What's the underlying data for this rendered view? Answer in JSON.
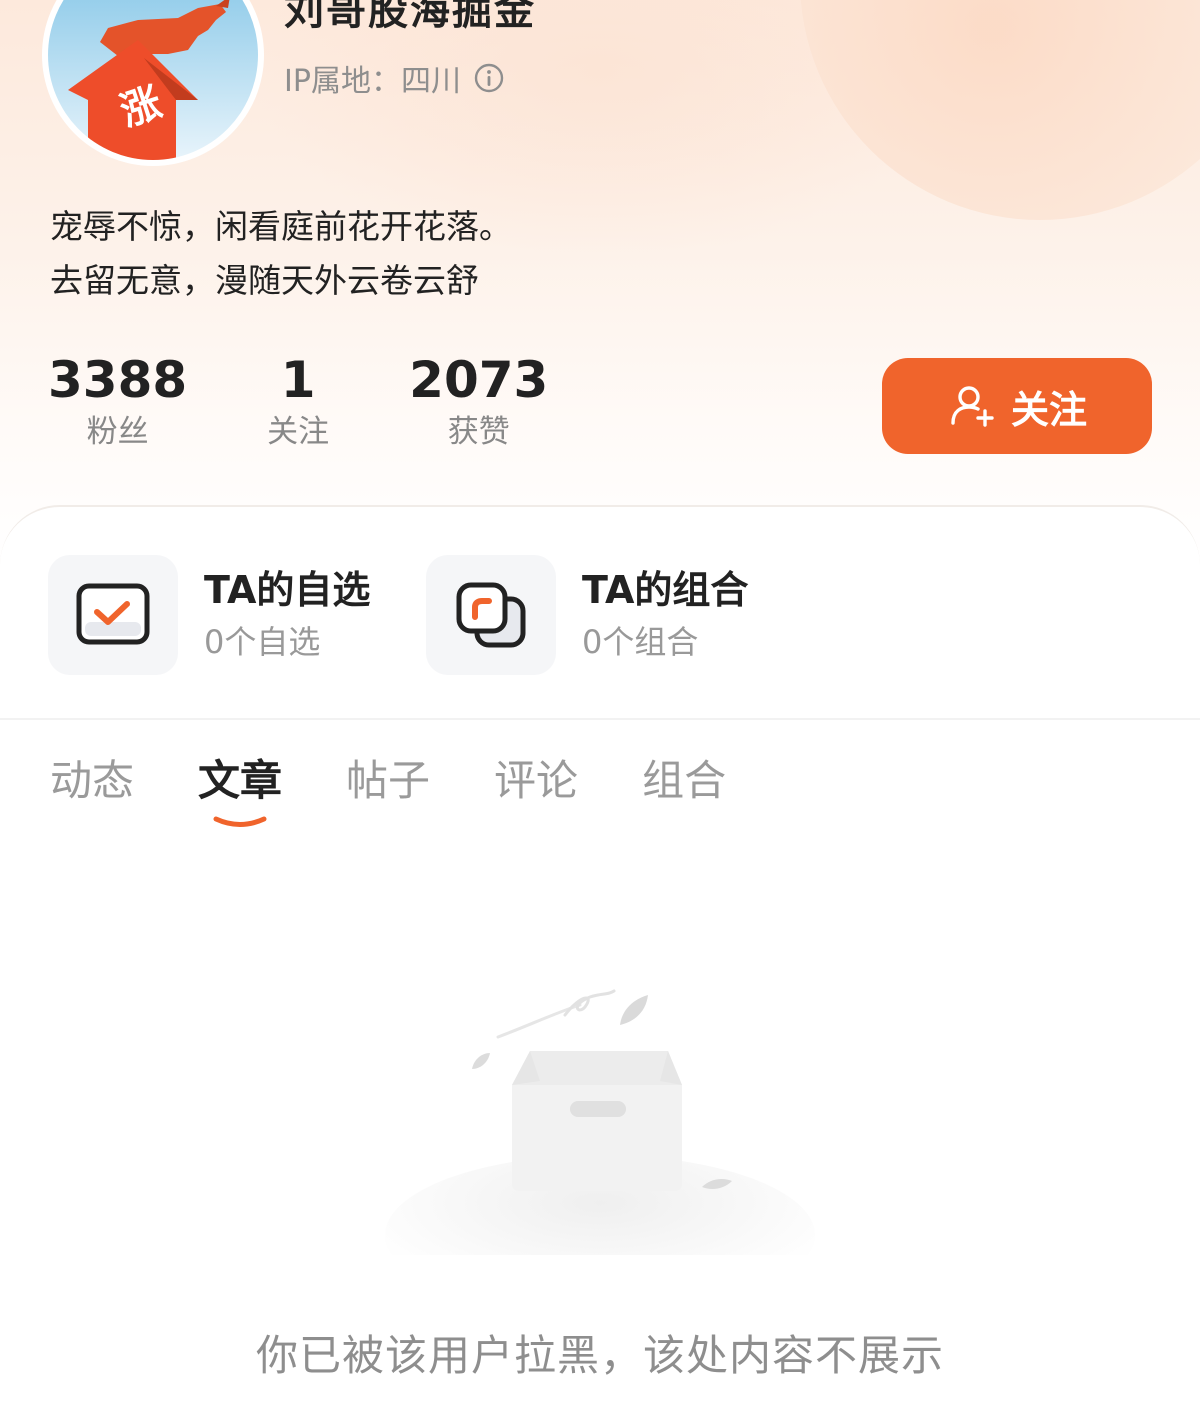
{
  "profile": {
    "username": "刘哥股海掘金",
    "avatar_text": "涨",
    "ip_location": "IP属地：四川",
    "bio_line1": "宠辱不惊，闲看庭前花开花落。",
    "bio_line2": "去留无意，漫随天外云卷云舒"
  },
  "stats": [
    {
      "value": "3388",
      "label": "粉丝"
    },
    {
      "value": "1",
      "label": "关注"
    },
    {
      "value": "2073",
      "label": "获赞"
    }
  ],
  "follow_button": {
    "label": "关注",
    "icon": "add-user-icon"
  },
  "entries": {
    "watchlist": {
      "title": "TA的自选",
      "count": "0个自选",
      "icon": "checkbox-icon"
    },
    "portfolio": {
      "title": "TA的组合",
      "count": "0个组合",
      "icon": "stacked-squares-icon"
    }
  },
  "tabs": [
    {
      "label": "动态",
      "active": false
    },
    {
      "label": "文章",
      "active": true
    },
    {
      "label": "帖子",
      "active": false
    },
    {
      "label": "评论",
      "active": false
    },
    {
      "label": "组合",
      "active": false
    }
  ],
  "empty_state": {
    "message": "你已被该用户拉黑，该处内容不展示",
    "icon": "empty-box-icon"
  },
  "colors": {
    "accent": "#f0642c",
    "text_primary": "#222222",
    "text_secondary": "#8e8e8e"
  }
}
